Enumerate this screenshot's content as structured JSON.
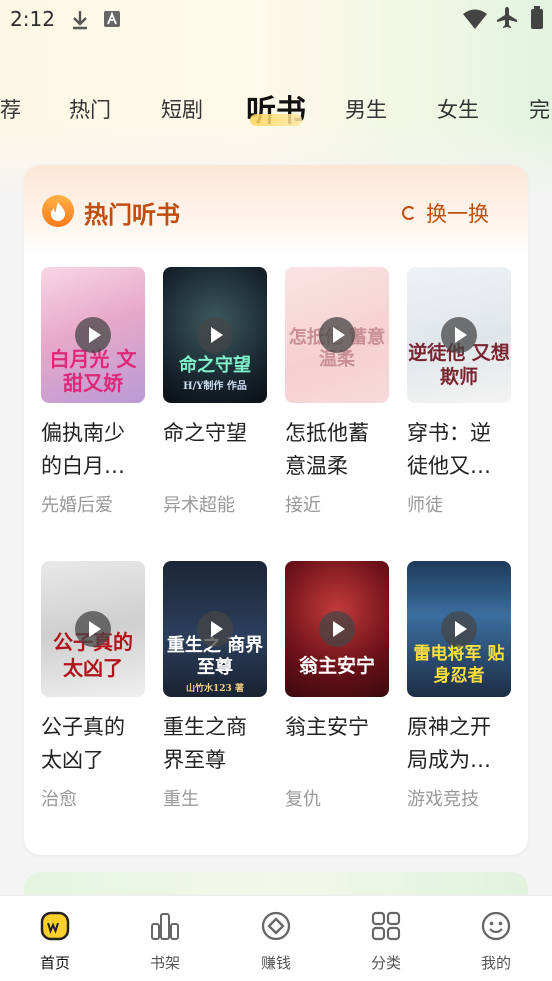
{
  "status_bar": {
    "time": "2:12"
  },
  "tabs": [
    "荐",
    "热门",
    "短剧",
    "听书",
    "男生",
    "女生",
    "完"
  ],
  "active_tab": "听书",
  "section": {
    "title": "热门听书",
    "refresh_label": "换一换"
  },
  "books": [
    {
      "title": "偏执南少的白月…",
      "tag": "先婚后爱",
      "cover_text": "白月光 文甜又娇"
    },
    {
      "title": "命之守望",
      "tag": "异术超能",
      "cover_text": "命之守望",
      "cover_sub": "H/Y制作 作品"
    },
    {
      "title": "怎抵他蓄意温柔",
      "tag": "接近",
      "cover_text": "怎抵他 蓄意温柔"
    },
    {
      "title": "穿书：逆徒他又…",
      "tag": "师徒",
      "cover_text": "逆徒他 又想欺师"
    },
    {
      "title": "公子真的太凶了",
      "tag": "治愈",
      "cover_text": "公子真的 太凶了"
    },
    {
      "title": "重生之商界至尊",
      "tag": "重生",
      "cover_text": "重生之 商界至尊",
      "cover_sub": "山竹水123 著"
    },
    {
      "title": "翁主安宁",
      "tag": "复仇",
      "cover_text": "翁主安宁"
    },
    {
      "title": "原神之开局成为…",
      "tag": "游戏竞技",
      "cover_text": "雷电将军 贴身忍者"
    }
  ],
  "bottom_nav": [
    {
      "label": "首页",
      "icon": "home-icon"
    },
    {
      "label": "书架",
      "icon": "bookshelf-icon"
    },
    {
      "label": "赚钱",
      "icon": "earn-icon"
    },
    {
      "label": "分类",
      "icon": "category-icon"
    },
    {
      "label": "我的",
      "icon": "profile-icon"
    }
  ],
  "colors": {
    "accent": "#c04e0d",
    "tab_highlight": "#ffd55a"
  }
}
